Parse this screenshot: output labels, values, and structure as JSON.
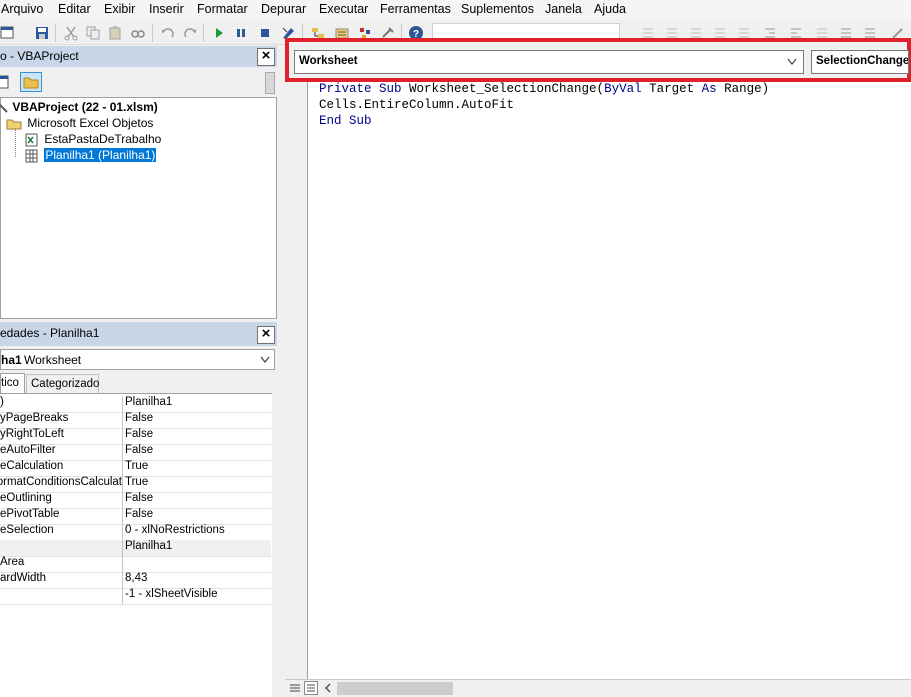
{
  "menu": [
    "Arquivo",
    "Editar",
    "Exibir",
    "Inserir",
    "Formatar",
    "Depurar",
    "Executar",
    "Ferramentas",
    "Suplementos",
    "Janela",
    "Ajuda"
  ],
  "project": {
    "title": "o - VBAProject",
    "root": "VBAProject (22 - 01.xlsm)",
    "folder": "Microsoft Excel Objetos",
    "items": [
      "EstaPastaDeTrabalho",
      "Planilha1 (Planilha1)"
    ]
  },
  "properties": {
    "title": "edades - Planilha1",
    "object_bold": "ha1",
    "object_type": "Worksheet",
    "tabs": [
      "tico",
      "Categorizado"
    ],
    "rows": [
      {
        "k": ")",
        "v": "Planilha1"
      },
      {
        "k": "yPageBreaks",
        "v": "False"
      },
      {
        "k": "yRightToLeft",
        "v": "False"
      },
      {
        "k": "eAutoFilter",
        "v": "False"
      },
      {
        "k": "eCalculation",
        "v": "True"
      },
      {
        "k": "eFormatConditionsCalculat",
        "v": "True"
      },
      {
        "k": "eOutlining",
        "v": "False"
      },
      {
        "k": "ePivotTable",
        "v": "False"
      },
      {
        "k": "eSelection",
        "v": "0 - xlNoRestrictions"
      },
      {
        "k": "",
        "v": "Planilha1"
      },
      {
        "k": "Area",
        "v": ""
      },
      {
        "k": "ardWidth",
        "v": "8,43"
      },
      {
        "k": "",
        "v": "-1 - xlSheetVisible"
      }
    ]
  },
  "code_window": {
    "object_combo": "Worksheet",
    "procedure_combo": "SelectionChange",
    "lines": [
      {
        "kw1": "Private Sub ",
        "rest": "Worksheet_SelectionChange(",
        "kw2": "ByVal ",
        "rest2": "Target ",
        "kw3": "As ",
        "rest3": "Range)"
      },
      {
        "kw1": "",
        "rest": "Cells.EntireColumn.AutoFit",
        "kw2": "",
        "rest2": "",
        "kw3": "",
        "rest3": ""
      },
      {
        "kw1": "End Sub",
        "rest": "",
        "kw2": "",
        "rest2": "",
        "kw3": "",
        "rest3": ""
      }
    ]
  },
  "colors": {
    "highlight": "#e0202a",
    "selection": "#0078d7",
    "keyword": "#00008b"
  }
}
